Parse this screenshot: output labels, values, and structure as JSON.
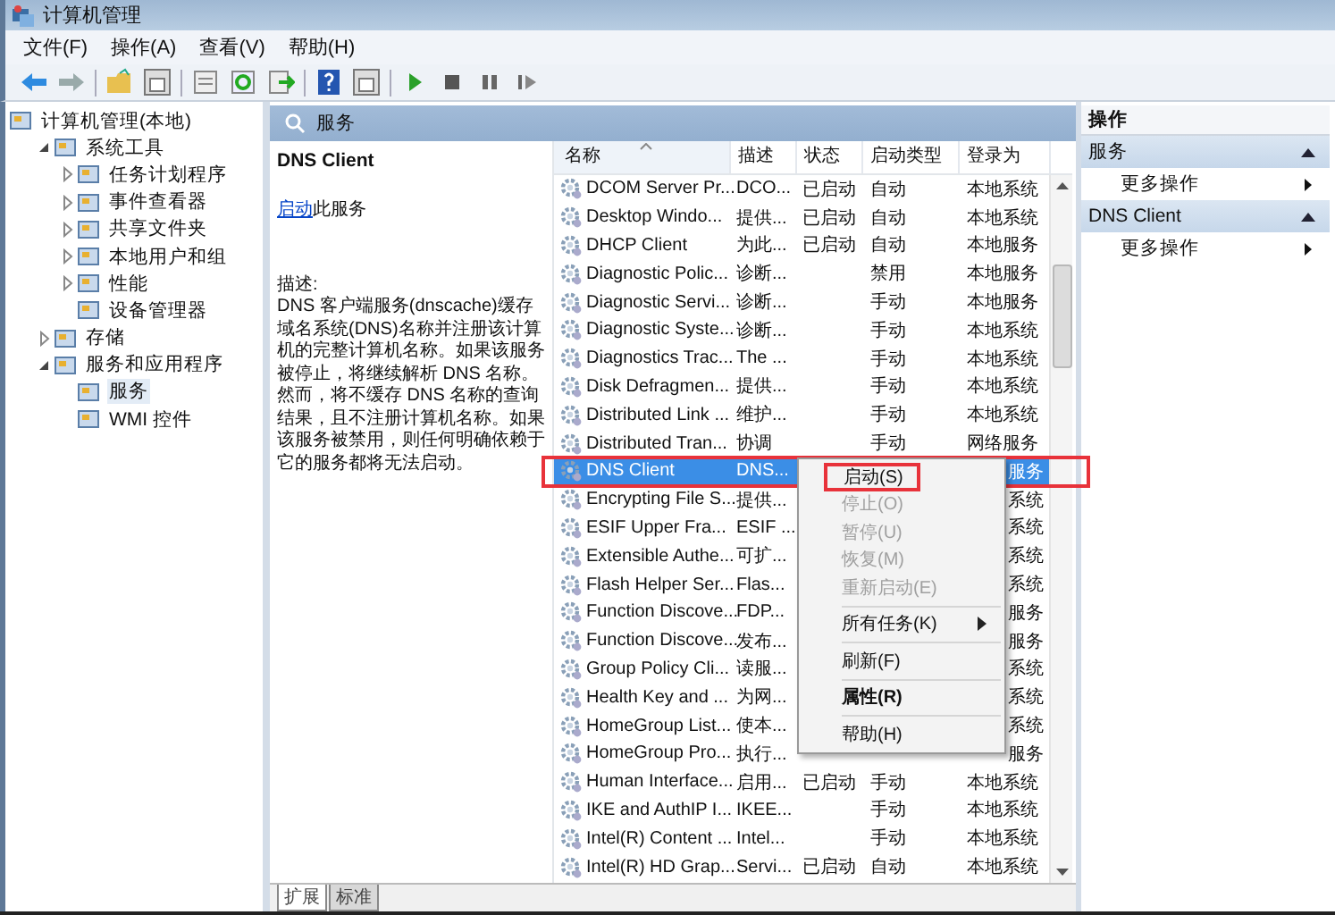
{
  "window": {
    "title": "计算机管理"
  },
  "menu": [
    "文件(F)",
    "操作(A)",
    "查看(V)",
    "帮助(H)"
  ],
  "tree": {
    "label": "计算机管理(本地)",
    "selected": false,
    "children": [
      {
        "label": "系统工具",
        "selected": false,
        "expanded": true,
        "children": [
          {
            "label": "任务计划程序",
            "selected": false,
            "expanded": false
          },
          {
            "label": "事件查看器",
            "selected": false,
            "expanded": false
          },
          {
            "label": "共享文件夹",
            "selected": false,
            "expanded": false
          },
          {
            "label": "本地用户和组",
            "selected": false,
            "expanded": false
          },
          {
            "label": "性能",
            "selected": false,
            "expanded": false
          },
          {
            "label": "设备管理器",
            "selected": false
          }
        ]
      },
      {
        "label": "存储",
        "selected": false,
        "expanded": false
      },
      {
        "label": "服务和应用程序",
        "selected": false,
        "expanded": true,
        "children": [
          {
            "label": "服务",
            "selected": true
          },
          {
            "label": "WMI 控件",
            "selected": false
          }
        ]
      }
    ]
  },
  "pane_title": "服务",
  "detail": {
    "title": "DNS Client",
    "action_link": "启动",
    "action_text": "此服务",
    "description_label": "描述:",
    "description": "DNS 客户端服务(dnscache)缓存域名系统(DNS)名称并注册该计算机的完整计算机名称。如果该服务被停止，将继续解析 DNS 名称。然而，将不缓存 DNS 名称的查询结果，且不注册计算机名称。如果该服务被禁用，则任何明确依赖于它的服务都将无法启动。"
  },
  "table": {
    "columns": [
      "名称",
      "描述",
      "状态",
      "启动类型",
      "登录为"
    ],
    "rows": [
      {
        "name": "DCOM Server Pr...",
        "desc": "DCO...",
        "status": "已启动",
        "startup": "自动",
        "logon": "本地系统",
        "selected": false,
        "outlined": false
      },
      {
        "name": "Desktop Windo...",
        "desc": "提供...",
        "status": "已启动",
        "startup": "自动",
        "logon": "本地系统",
        "selected": false,
        "outlined": false
      },
      {
        "name": "DHCP Client",
        "desc": "为此...",
        "status": "已启动",
        "startup": "自动",
        "logon": "本地服务",
        "selected": false,
        "outlined": false
      },
      {
        "name": "Diagnostic Polic...",
        "desc": "诊断...",
        "startup": "禁用",
        "logon": "本地服务",
        "selected": false,
        "outlined": false
      },
      {
        "name": "Diagnostic Servi...",
        "desc": "诊断...",
        "startup": "手动",
        "logon": "本地服务",
        "selected": false,
        "outlined": false
      },
      {
        "name": "Diagnostic Syste...",
        "desc": "诊断...",
        "startup": "手动",
        "logon": "本地系统",
        "selected": false,
        "outlined": false
      },
      {
        "name": "Diagnostics Trac...",
        "desc": "The ...",
        "startup": "手动",
        "logon": "本地系统",
        "selected": false,
        "outlined": false
      },
      {
        "name": "Disk Defragmen...",
        "desc": "提供...",
        "startup": "手动",
        "logon": "本地系统",
        "selected": false,
        "outlined": false
      },
      {
        "name": "Distributed Link ...",
        "desc": "维护...",
        "startup": "手动",
        "logon": "本地系统",
        "selected": false,
        "outlined": false
      },
      {
        "name": "Distributed Tran...",
        "desc": "协调",
        "startup": "手动",
        "logon": "网络服务",
        "selected": false,
        "outlined": false
      },
      {
        "name": "DNS Client",
        "desc": "DNS...",
        "logon": "服务",
        "covered": true,
        "selected": true,
        "outlined": true
      },
      {
        "name": "Encrypting File S...",
        "desc": "提供...",
        "logon": "系统",
        "covered": true,
        "selected": false,
        "outlined": false
      },
      {
        "name": "ESIF Upper Fra...",
        "desc": "ESIF ...",
        "logon": "系统",
        "covered": true,
        "selected": false,
        "outlined": false
      },
      {
        "name": "Extensible Authe...",
        "desc": "可扩...",
        "logon": "系统",
        "covered": true,
        "selected": false,
        "outlined": false
      },
      {
        "name": "Flash Helper Ser...",
        "desc": "Flas...",
        "logon": "系统",
        "covered": true,
        "selected": false,
        "outlined": false
      },
      {
        "name": "Function Discove...",
        "desc": "FDP...",
        "logon": "服务",
        "covered": true,
        "selected": false,
        "outlined": false
      },
      {
        "name": "Function Discove...",
        "desc": "发布...",
        "logon": "服务",
        "covered": true,
        "selected": false,
        "outlined": false
      },
      {
        "name": "Group Policy Cli...",
        "desc": "读服...",
        "logon": "系统",
        "covered": true,
        "selected": false,
        "outlined": false
      },
      {
        "name": "Health Key and ...",
        "desc": "为网...",
        "logon": "系统",
        "covered": true,
        "selected": false,
        "outlined": false
      },
      {
        "name": "HomeGroup List...",
        "desc": "使本...",
        "logon": "系统",
        "covered": true,
        "selected": false,
        "outlined": false
      },
      {
        "name": "HomeGroup Pro...",
        "desc": "执行...",
        "logon": "服务",
        "covered": true,
        "selected": false,
        "outlined": false
      },
      {
        "name": "Human Interface...",
        "desc": "启用...",
        "status": "已启动",
        "startup": "手动",
        "logon": "本地系统",
        "selected": false,
        "outlined": false
      },
      {
        "name": "IKE and AuthIP I...",
        "desc": "IKEE...",
        "startup": "手动",
        "logon": "本地系统",
        "selected": false,
        "outlined": false
      },
      {
        "name": "Intel(R) Content ...",
        "desc": "Intel...",
        "startup": "手动",
        "logon": "本地系统",
        "selected": false,
        "outlined": false
      },
      {
        "name": "Intel(R) HD Grap...",
        "desc": "Servi...",
        "status": "已启动",
        "startup": "自动",
        "logon": "本地系统",
        "selected": false,
        "outlined": false
      }
    ]
  },
  "context_menu": [
    {
      "kind": "item",
      "label": "启动(S)",
      "disabled": false,
      "bold": false,
      "outlined": true
    },
    {
      "kind": "item",
      "label": "停止(O)",
      "disabled": true,
      "bold": false,
      "outlined": false
    },
    {
      "kind": "item",
      "label": "暂停(U)",
      "disabled": true,
      "bold": false,
      "outlined": false
    },
    {
      "kind": "item",
      "label": "恢复(M)",
      "disabled": true,
      "bold": false,
      "outlined": false
    },
    {
      "kind": "item",
      "label": "重新启动(E)",
      "disabled": true,
      "bold": false,
      "outlined": false
    },
    {
      "kind": "separator"
    },
    {
      "kind": "submenu",
      "label": "所有任务(K)",
      "disabled": false,
      "bold": false,
      "outlined": false
    },
    {
      "kind": "separator"
    },
    {
      "kind": "item",
      "label": "刷新(F)",
      "disabled": false,
      "bold": false,
      "outlined": false
    },
    {
      "kind": "separator"
    },
    {
      "kind": "item",
      "label": "属性(R)",
      "disabled": false,
      "bold": true,
      "outlined": false
    },
    {
      "kind": "separator"
    },
    {
      "kind": "item",
      "label": "帮助(H)",
      "disabled": false,
      "bold": false,
      "outlined": false
    }
  ],
  "view_tabs": [
    {
      "label": "扩展",
      "selected": true
    },
    {
      "label": "标准",
      "selected": false
    }
  ],
  "actions": {
    "title": "操作",
    "sections": [
      {
        "title": "服务",
        "items": [
          "更多操作"
        ]
      },
      {
        "title": "DNS Client",
        "items": [
          "更多操作"
        ]
      }
    ]
  }
}
